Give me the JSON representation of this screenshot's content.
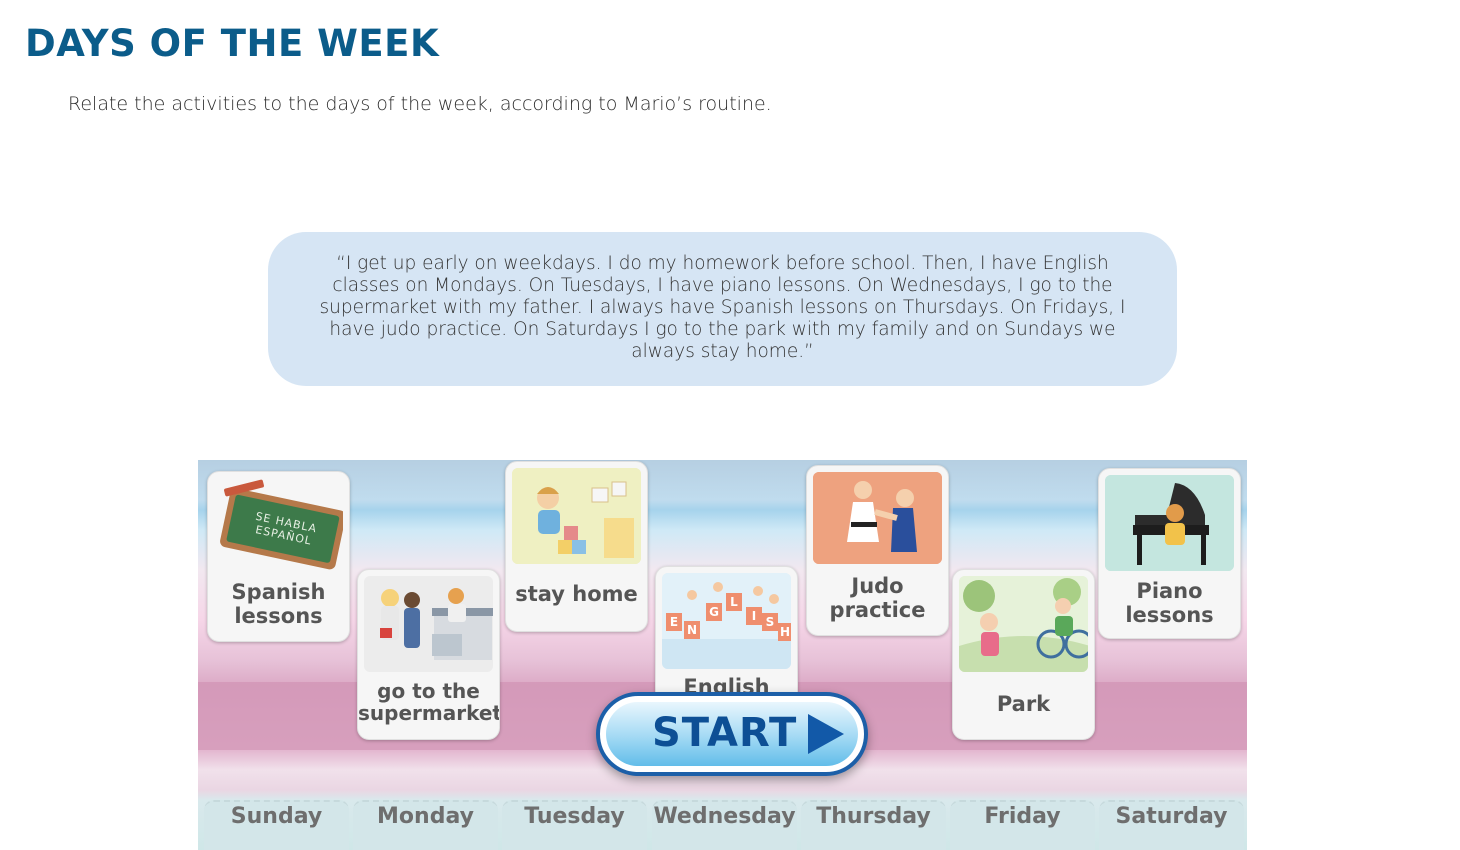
{
  "page": {
    "title": "DAYS OF THE WEEK",
    "instruction": "Relate the activities to the days of the week, according to Mario’s routine."
  },
  "quote": {
    "text": "“I get up early on weekdays. I do my homework before school. Then, I have English classes on Mondays. On Tuesdays, I have piano lessons. On Wednesdays, I go to the supermarket with my father. I always have Spanish lessons on Thursdays. On Fridays, I have judo practice. On Saturdays I go to the park with my family and on Sundays we always stay home.”"
  },
  "game": {
    "start_label": "START",
    "chalkboard_text": "SE HABLA ESPAÑOL",
    "english_letters": [
      "E",
      "N",
      "G",
      "L",
      "I",
      "S",
      "H"
    ],
    "cards": [
      {
        "label_1": "Spanish",
        "label_2": "lessons"
      },
      {
        "label_1": "go to the",
        "label_2": "supermarket"
      },
      {
        "label_1": "stay home",
        "label_2": ""
      },
      {
        "label_1": "English",
        "label_2": ""
      },
      {
        "label_1": "Judo",
        "label_2": "practice"
      },
      {
        "label_1": "Park",
        "label_2": ""
      },
      {
        "label_1": "Piano",
        "label_2": "lessons"
      }
    ],
    "days": [
      "Sunday",
      "Monday",
      "Tuesday",
      "Wednesday",
      "Thursday",
      "Friday",
      "Saturday"
    ]
  },
  "colors": {
    "title": "#0b5c8a",
    "quote_bg": "#d6e5f4",
    "start_text": "#0d4f95"
  }
}
